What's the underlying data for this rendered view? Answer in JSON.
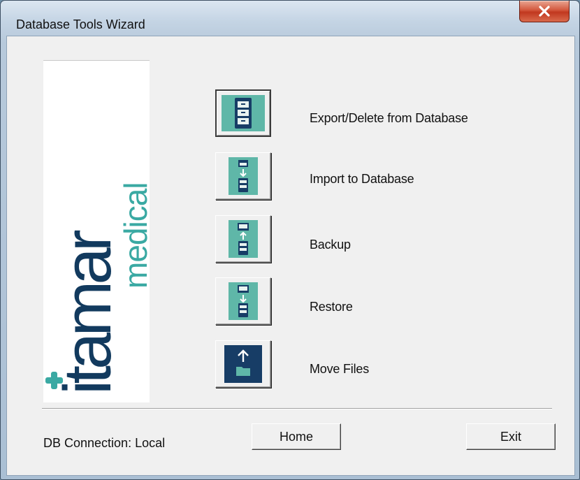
{
  "window": {
    "title": "Database Tools Wizard"
  },
  "logo": {
    "brand_main": "itamar",
    "brand_sub": "medical",
    "colors": {
      "main": "#123a5e",
      "sub": "#3aa9a3",
      "cross": "#3aa9a3"
    }
  },
  "tools": [
    {
      "label": "Export/Delete from Database",
      "icon": "database-cabinet-icon"
    },
    {
      "label": "Import to Database",
      "icon": "import-to-database-icon"
    },
    {
      "label": "Backup",
      "icon": "backup-icon"
    },
    {
      "label": "Restore",
      "icon": "restore-icon"
    },
    {
      "label": "Move Files",
      "icon": "move-files-icon"
    }
  ],
  "footer": {
    "status": "DB Connection: Local",
    "home_label": "Home",
    "exit_label": "Exit"
  },
  "colors": {
    "icon_teal": "#5fb7a8",
    "icon_navy": "#173d66",
    "close_red": "#c9452a"
  }
}
